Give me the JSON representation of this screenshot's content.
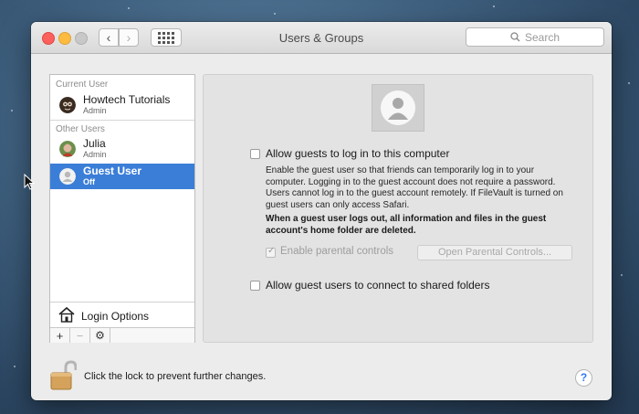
{
  "window": {
    "title": "Users & Groups"
  },
  "search": {
    "placeholder": "Search"
  },
  "sidebar": {
    "current_user_header": "Current User",
    "current_user": {
      "name": "Howtech Tutorials",
      "role": "Admin"
    },
    "other_users_header": "Other Users",
    "other_users": [
      {
        "name": "Julia",
        "role": "Admin"
      },
      {
        "name": "Guest User",
        "role": "Off",
        "selected": true
      }
    ],
    "login_options_label": "Login Options",
    "add_label": "+",
    "remove_label": "−"
  },
  "pane": {
    "allow_guests_label": "Allow guests to log in to this computer",
    "allow_guests_checked": false,
    "description": "Enable the guest user so that friends can temporarily log in to your computer. Logging in to the guest account does not require a password. Users cannot log in to the guest account remotely. If FileVault is turned on guest users can only access Safari.",
    "warning": "When a guest user logs out, all information and files in the guest account's home folder are deleted.",
    "parental_controls_label": "Enable parental controls",
    "parental_controls_checked": true,
    "open_parental_button": "Open Parental Controls...",
    "shared_folders_label": "Allow guest users to connect to shared folders",
    "shared_folders_checked": false
  },
  "footer": {
    "lock_text": "Click the lock to prevent further changes.",
    "help_label": "?"
  },
  "colors": {
    "selection": "#3b7ed8",
    "accent": "#3478f6"
  }
}
